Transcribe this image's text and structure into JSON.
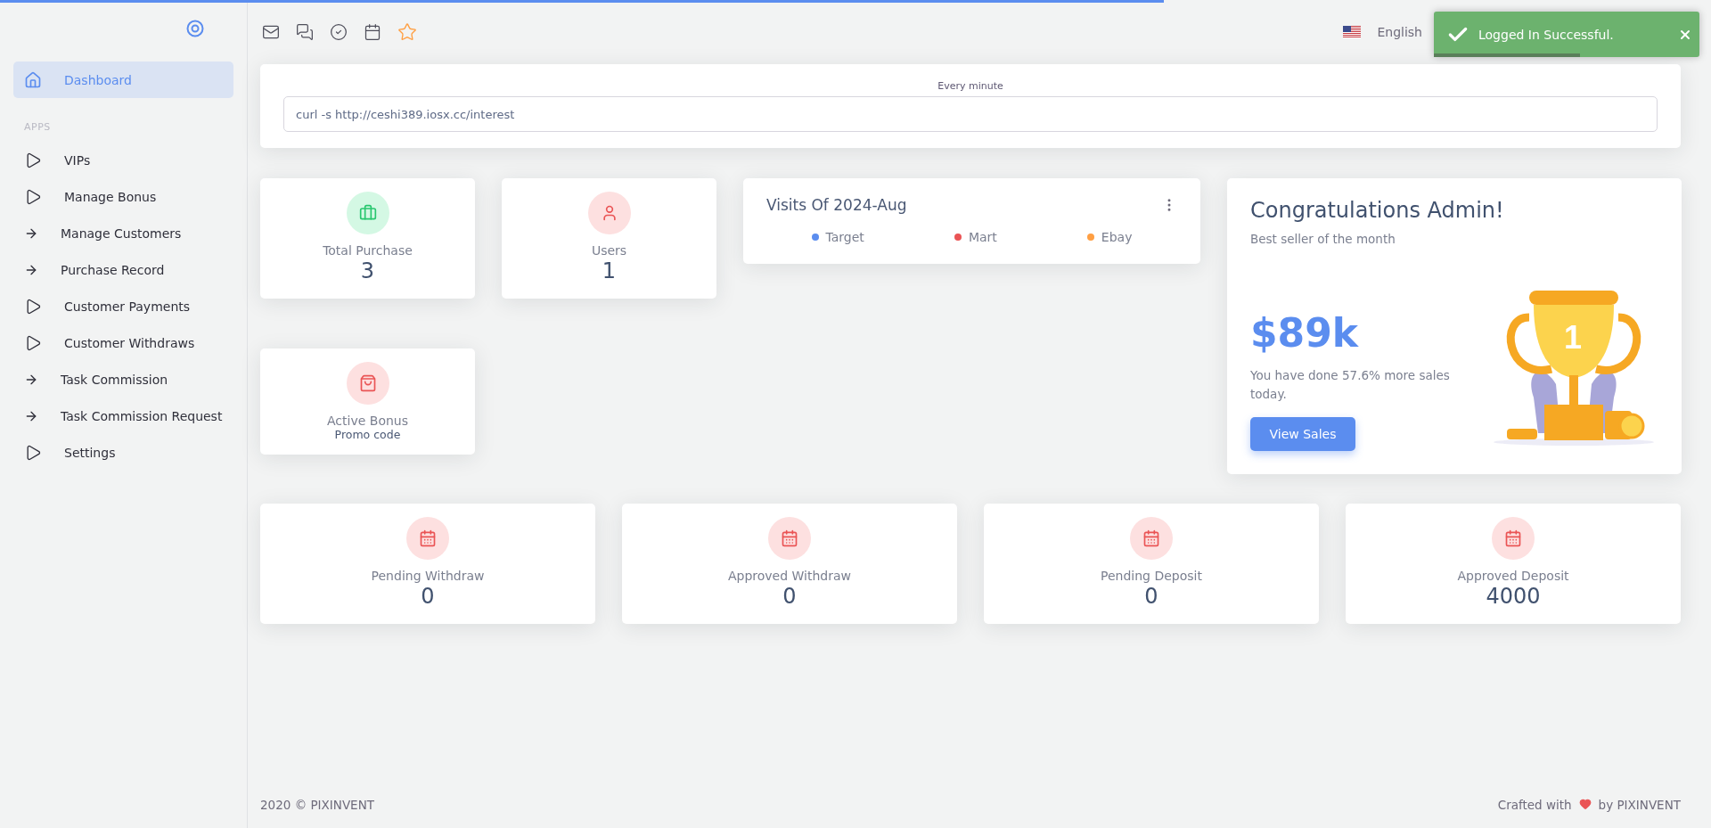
{
  "page_progress": {
    "level": 0.68
  },
  "sidebar": {
    "items": [
      {
        "label": "Dashboard",
        "kind": "home",
        "selected": true
      }
    ],
    "section": "APPS",
    "apps": [
      {
        "label": "VIPs",
        "kind": "triangle",
        "selected": false
      },
      {
        "label": "Manage Bonus",
        "kind": "triangle",
        "selected": false
      },
      {
        "label": "Manage Customers",
        "kind": "arrow",
        "selected": false
      },
      {
        "label": "Purchase Record",
        "kind": "arrow",
        "selected": false
      },
      {
        "label": "Customer Payments",
        "kind": "triangle",
        "selected": false
      },
      {
        "label": "Customer Withdraws",
        "kind": "triangle",
        "selected": false
      },
      {
        "label": "Task Commission",
        "kind": "arrow",
        "selected": false
      },
      {
        "label": "Task Commission Request",
        "kind": "arrow",
        "selected": false
      },
      {
        "label": "Settings",
        "kind": "triangle",
        "selected": false
      }
    ]
  },
  "header": {
    "language": "English"
  },
  "toast": {
    "message": "Logged In Successful.",
    "level": 0.55
  },
  "cron": {
    "label": "Every minute",
    "value": "curl -s http://ceshi389.iosx.cc/interest"
  },
  "stats": [
    {
      "label": "Total Purchase",
      "value": "3",
      "kind": "briefcase"
    },
    {
      "label": "Users",
      "value": "1",
      "kind": "user"
    }
  ],
  "visits": {
    "title": "Visits Of 2024-Aug",
    "legend": [
      {
        "label": "Target",
        "color": "#5b8def"
      },
      {
        "label": "Mart",
        "color": "#ea5455"
      },
      {
        "label": "Ebay",
        "color": "#ff9f43"
      }
    ]
  },
  "bonus": {
    "label": "Active Bonus",
    "sub": "Promo code"
  },
  "congrats": {
    "title": "Congratulations Admin!",
    "subtitle": "Best seller of the month",
    "amount": "$89k",
    "text": "You have done 57.6% more sales today.",
    "button": "View Sales",
    "trophy_number": "1"
  },
  "totals": [
    {
      "label": "Pending Withdraw",
      "value": "0"
    },
    {
      "label": "Approved Withdraw",
      "value": "0"
    },
    {
      "label": "Pending Deposit",
      "value": "0"
    },
    {
      "label": "Approved Deposit",
      "value": "4000"
    }
  ],
  "footer": {
    "left": "2020 © PIXINVENT",
    "right_before": "Crafted with",
    "right_after": "by PIXINVENT"
  }
}
